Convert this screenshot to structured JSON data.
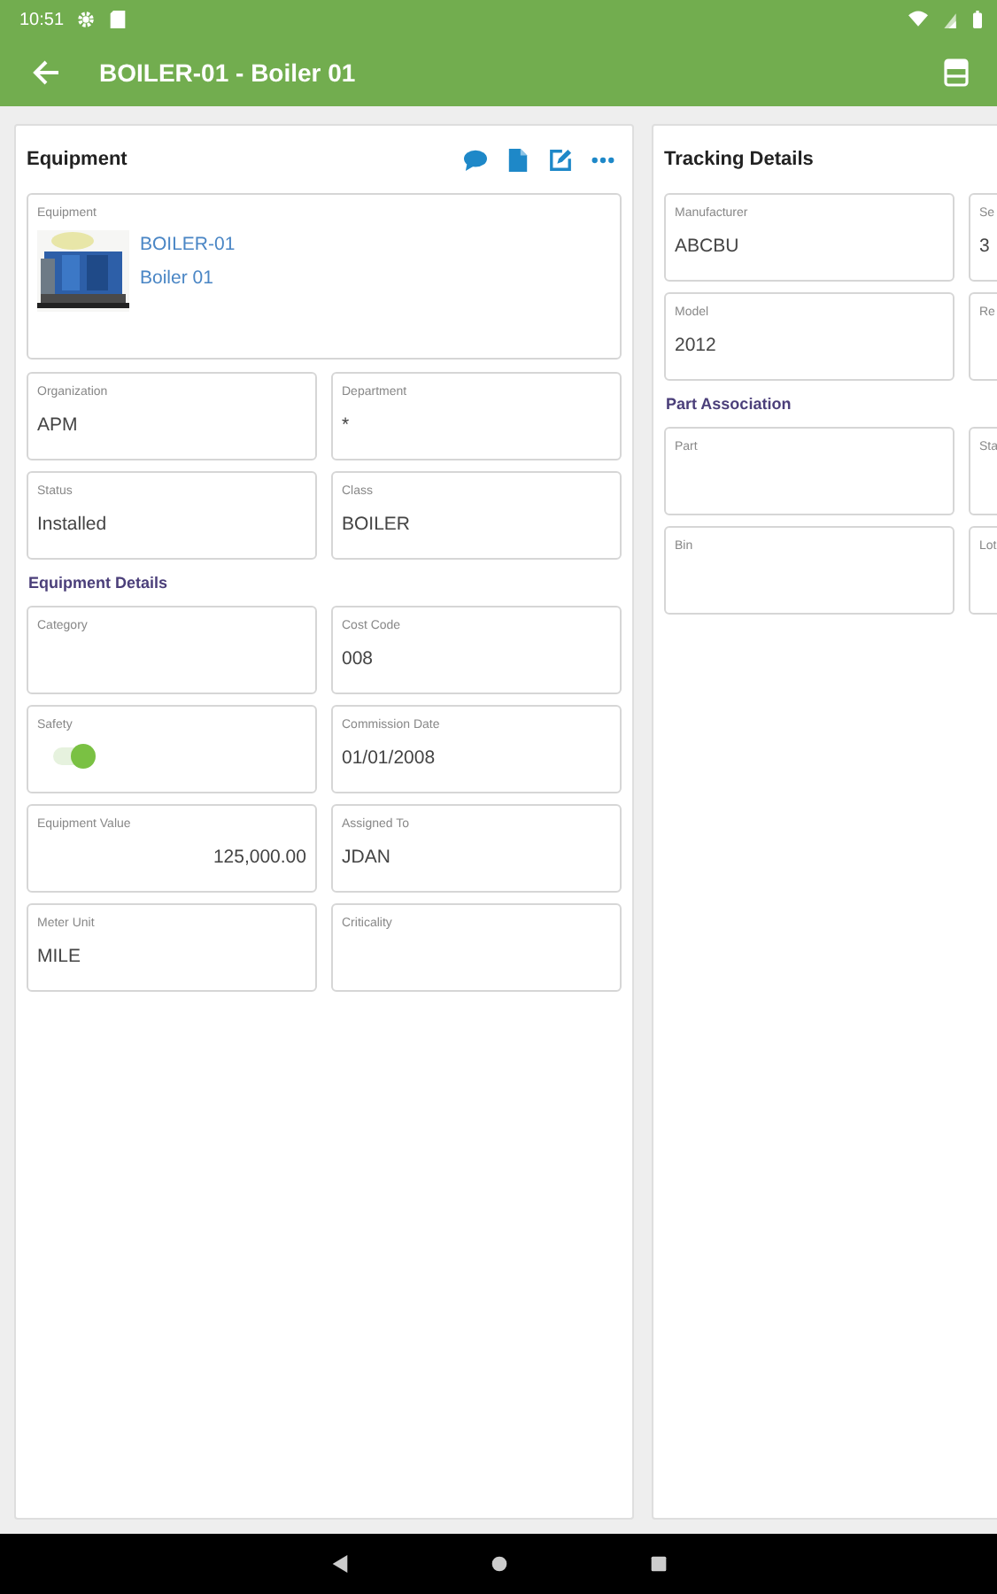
{
  "status_bar": {
    "time": "10:51"
  },
  "app_bar": {
    "title": "BOILER-01 - Boiler 01"
  },
  "equipment_card": {
    "title": "Equipment",
    "equipment_field": {
      "label": "Equipment",
      "code": "BOILER-01",
      "description": "Boiler 01"
    },
    "fields": [
      {
        "label": "Organization",
        "value": "APM"
      },
      {
        "label": "Department",
        "value": "*"
      },
      {
        "label": "Status",
        "value": "Installed"
      },
      {
        "label": "Class",
        "value": "BOILER"
      }
    ],
    "section": "Equipment Details",
    "detail_fields": [
      {
        "label": "Category",
        "kind": "text"
      },
      {
        "label": "Cost Code",
        "value": "008",
        "kind": "text"
      },
      {
        "label": "Safety",
        "kind": "toggle",
        "on": true
      },
      {
        "label": "Commission Date",
        "value": "01/01/2008",
        "kind": "text"
      },
      {
        "label": "Equipment Value",
        "value": "125,000.00",
        "kind": "amount"
      },
      {
        "label": "Assigned To",
        "value": "JDAN",
        "kind": "text"
      },
      {
        "label": "Meter Unit",
        "value": "MILE",
        "kind": "text"
      },
      {
        "label": "Criticality",
        "kind": "text"
      }
    ]
  },
  "tracking_card": {
    "title": "Tracking Details",
    "fields": [
      {
        "label": "Manufacturer",
        "value": "ABCBU"
      },
      {
        "label": "Se",
        "value": "3"
      },
      {
        "label": "Model",
        "value": "2012"
      },
      {
        "label": "Re"
      }
    ],
    "section": "Part Association",
    "part_fields": [
      {
        "label": "Part"
      },
      {
        "label": "Sta"
      },
      {
        "label": "Bin"
      },
      {
        "label": "Lot"
      }
    ]
  }
}
